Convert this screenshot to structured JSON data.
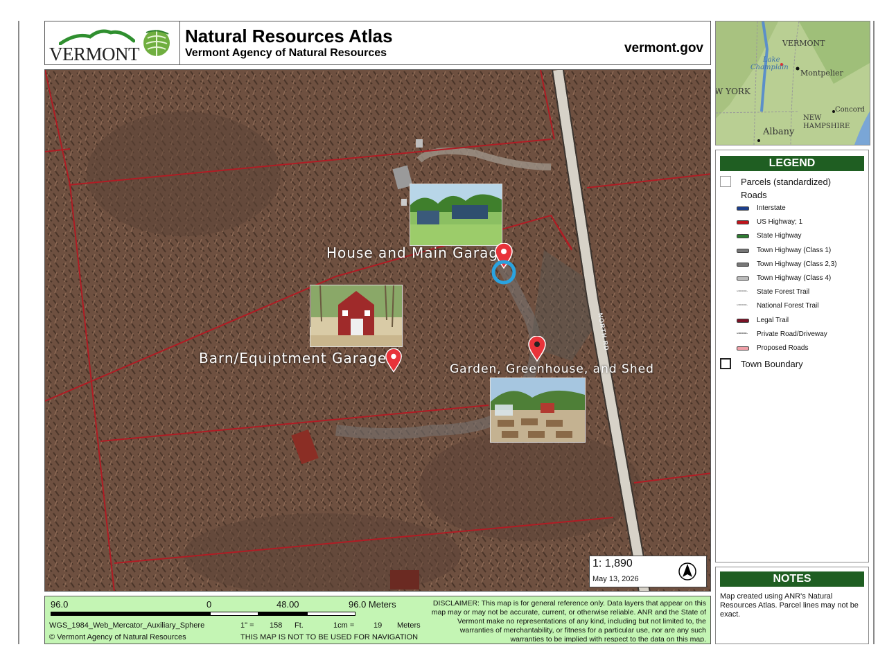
{
  "header": {
    "state_logo_text": "VERMONT",
    "title": "Natural Resources Atlas",
    "subtitle": "Vermont Agency of Natural Resources",
    "site": "vermont.gov"
  },
  "map": {
    "labels": {
      "house": "House and Main Garage",
      "barn": "Barn/Equiptment Garage",
      "garden": "Garden, Greenhouse, and Shed"
    },
    "road_label": "NORTH RD",
    "scale_ratio": "1:  1,890",
    "date": "May 13, 2026"
  },
  "scalebar": {
    "left": "96.0",
    "zero": "0",
    "mid": "48.00",
    "right": "96.0 Meters",
    "projection": "WGS_1984_Web_Mercator_Auxiliary_Sphere",
    "copyright": "© Vermont Agency of Natural Resources",
    "inch_label": "1\" =",
    "inch_value": "158",
    "inch_unit": "Ft.",
    "cm_label": "1cm =",
    "cm_value": "19",
    "cm_unit": "Meters",
    "nav_warning": "THIS MAP IS NOT TO BE USED FOR NAVIGATION"
  },
  "disclaimer": "DISCLAIMER: This map is for general reference only. Data layers that appear on this map may or may not be accurate, current, or otherwise reliable. ANR and the State of Vermont make no representations of any kind, including but not limited to, the warranties of merchantability, or fitness for a particular use, nor are any such warranties to be implied with respect to the data on this map.",
  "inset": {
    "labels": {
      "vermont": "VERMONT",
      "lake": "Lake",
      "champlain": "Champlain",
      "montpelier": "Montpelier",
      "york": "W YORK",
      "concord": "Concord",
      "new": "NEW",
      "hampshire": "HAMPSHIRE",
      "albany": "Albany"
    }
  },
  "legend": {
    "title": "LEGEND",
    "parcels": "Parcels (standardized)",
    "roads_heading": "Roads",
    "roads": [
      {
        "label": "Interstate",
        "color": "#1d3f8a",
        "style": "solid"
      },
      {
        "label": "US Highway; 1",
        "color": "#c0141b",
        "style": "solid"
      },
      {
        "label": "State Highway",
        "color": "#2e7d32",
        "style": "solid"
      },
      {
        "label": "Town Highway (Class 1)",
        "color": "#777777",
        "style": "solid"
      },
      {
        "label": "Town Highway (Class 2,3)",
        "color": "#777777",
        "style": "solid"
      },
      {
        "label": "Town Highway (Class 4)",
        "color": "#bbbbbb",
        "style": "solid"
      },
      {
        "label": "State Forest Trail",
        "color": "#bbbbbb",
        "style": "dotted"
      },
      {
        "label": "National Forest Trail",
        "color": "#bbbbbb",
        "style": "dotted"
      },
      {
        "label": "Legal Trail",
        "color": "#7a1226",
        "style": "solid"
      },
      {
        "label": "Private Road/Driveway",
        "color": "#999999",
        "style": "dotted"
      },
      {
        "label": "Proposed Roads",
        "color": "#f0a0a8",
        "style": "solid"
      }
    ],
    "town_boundary": "Town Boundary"
  },
  "notes": {
    "title": "NOTES",
    "text": "Map created using ANR's Natural Resources Atlas. Parcel lines may not be exact."
  }
}
